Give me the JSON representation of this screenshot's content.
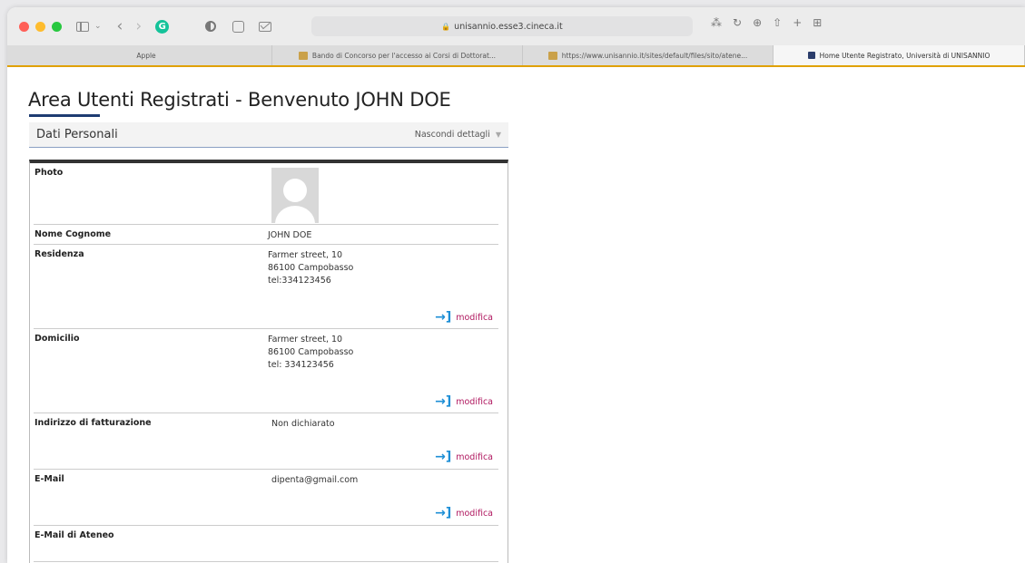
{
  "browser": {
    "address": "unisannio.esse3.cineca.it",
    "tabs": [
      {
        "label": "Apple"
      },
      {
        "label": "Bando di Concorso per l'accesso ai Corsi di Dottorat..."
      },
      {
        "label": "https://www.unisannio.it/sites/default/files/sito/atene..."
      },
      {
        "label": "Home Utente Registrato, Università di UNISANNIO"
      }
    ]
  },
  "page": {
    "title": "Area Utenti Registrati - Benvenuto JOHN DOE",
    "section_title": "Dati Personali",
    "toggle_label": "Nascondi dettagli"
  },
  "rows": [
    {
      "label": "Photo"
    },
    {
      "label": "Nome Cognome",
      "value": [
        "JOHN DOE"
      ]
    },
    {
      "label": "Residenza",
      "value": [
        "Farmer street, 10",
        "86100 Campobasso",
        "tel:334123456"
      ],
      "action": "modifica"
    },
    {
      "label": "Domicilio",
      "value": [
        "Farmer street, 10",
        "86100 Campobasso",
        "tel: 334123456"
      ],
      "action": "modifica"
    },
    {
      "label": "Indirizzo di fatturazione",
      "value": [
        "Non dichiarato"
      ],
      "action": "modifica"
    },
    {
      "label": "E-Mail",
      "value": [
        "dipenta@gmail.com"
      ],
      "action": "modifica"
    },
    {
      "label": "E-Mail di Ateneo"
    }
  ],
  "colors": {
    "accent": "#1e3c72",
    "action_link": "#b0175f",
    "action_icon": "#1e8fd6",
    "tab_underline": "#e0a100"
  },
  "icons": {
    "enter": "→]",
    "grammarly": "G"
  }
}
